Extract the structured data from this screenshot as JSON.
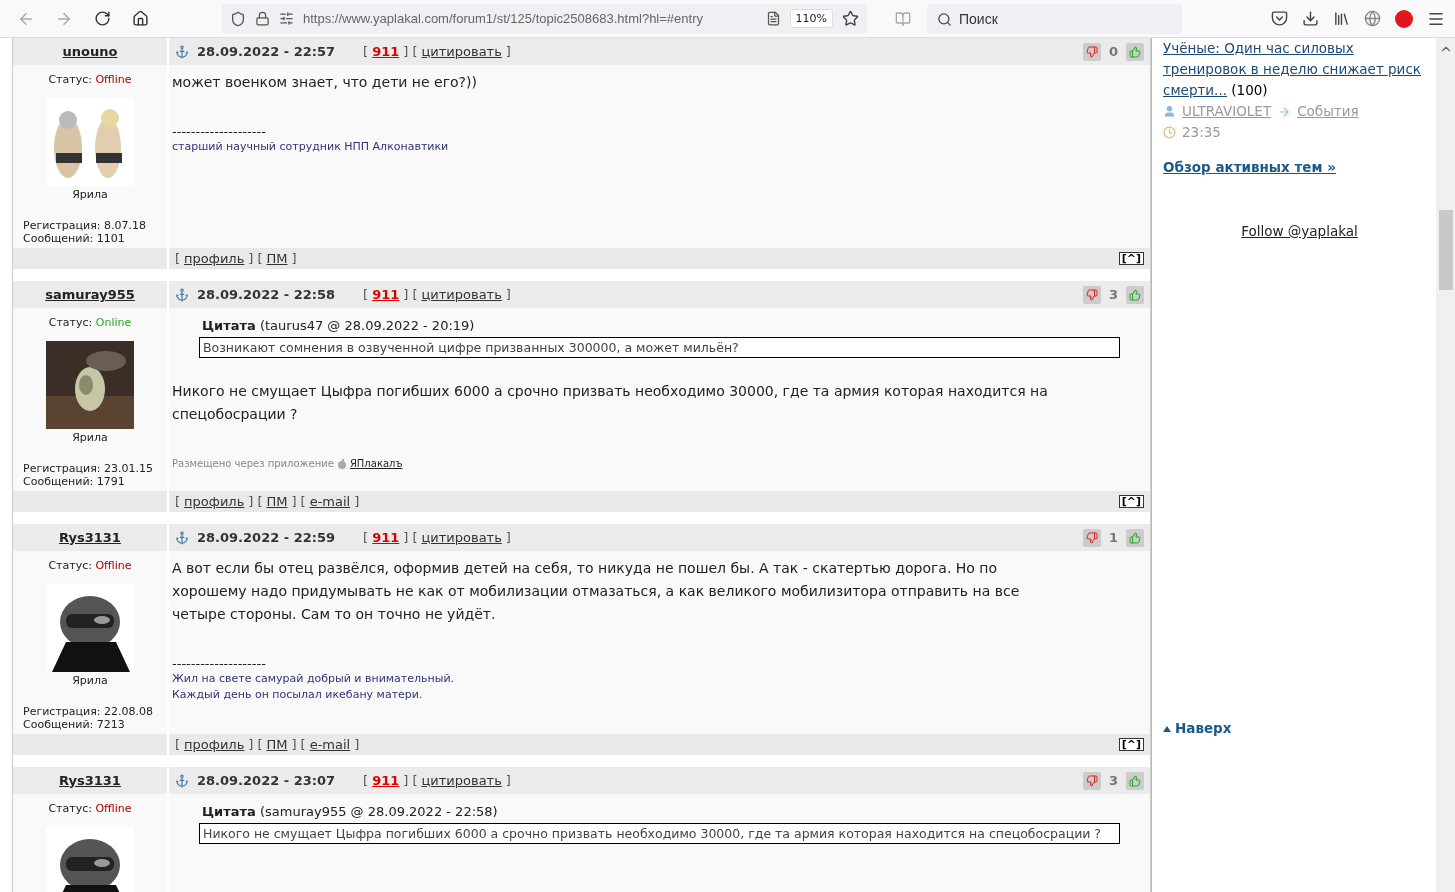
{
  "browser": {
    "url": "https://www.yaplakal.com/forum1/st/125/topic2508683.html?hl=#entry",
    "zoom": "110%",
    "search_placeholder": "Поиск"
  },
  "ui": {
    "bracket_open": "[",
    "bracket_close": "]"
  },
  "posts": [
    {
      "author": "unouno",
      "status_label": "Статус:",
      "status": "Offline",
      "online": false,
      "rank": "Ярила",
      "registration": "Регистрация: 8.07.18",
      "messages": "Сообщений: 1101",
      "date": "28.09.2022 - 22:57",
      "alert": "911",
      "quote_link": "цитировать",
      "rating": "0",
      "paragraphs": [
        "может военком знает, что дети не его?))"
      ],
      "signature_rule": "--------------------",
      "signature": [
        "старший научный сотрудник НПП Алконавтики"
      ],
      "footer_links": [
        "профиль",
        "ПМ"
      ],
      "top_link": "^"
    },
    {
      "author": "samuray955",
      "status_label": "Статус:",
      "status": "Online",
      "online": true,
      "rank": "Ярила",
      "registration": "Регистрация: 23.01.15",
      "messages": "Сообщений: 1791",
      "date": "28.09.2022 - 22:58",
      "alert": "911",
      "quote_link": "цитировать",
      "rating": "3",
      "quote": {
        "title": "Цитата",
        "meta": "(taurus47 @ 28.09.2022 - 20:19)",
        "text": "Возникают сомнения в озвученной цифре призванных 300000, а может мильён?"
      },
      "paragraphs": [
        "Никого не смущает Цыфра погибших 6000 а срочно призвать необходимо 30000, где та армия которая находится на спецобосрации ?"
      ],
      "via": {
        "label": "Размещено через приложение",
        "app": "ЯПлакалъ"
      },
      "footer_links": [
        "профиль",
        "ПМ",
        "e-mail"
      ],
      "top_link": "^"
    },
    {
      "author": "Rys3131",
      "status_label": "Статус:",
      "status": "Offline",
      "online": false,
      "rank": "Ярила",
      "registration": "Регистрация: 22.08.08",
      "messages": "Сообщений: 7213",
      "date": "28.09.2022 - 22:59",
      "alert": "911",
      "quote_link": "цитировать",
      "rating": "1",
      "paragraphs": [
        "А вот если бы отец развёлся, оформив детей на себя, то никуда не пошел бы. А так - скатертью дорога. Но по хорошему надо придумывать не как от мобилизации отмазаться, а как великого мобилизитора отправить на все четыре стороны. Сам то он точно не уйдёт."
      ],
      "signature_rule": "--------------------",
      "signature": [
        "Жил на свете самурай добрый и внимательный.",
        "Каждый день он посылал икебану матери."
      ],
      "footer_links": [
        "профиль",
        "ПМ",
        "e-mail"
      ],
      "top_link": "^"
    },
    {
      "author": "Rys3131",
      "status_label": "Статус:",
      "status": "Offline",
      "online": false,
      "date": "28.09.2022 - 23:07",
      "alert": "911",
      "quote_link": "цитировать",
      "rating": "3",
      "quote": {
        "title": "Цитата",
        "meta": "(samuray955 @ 28.09.2022 - 22:58)",
        "text": "Никого не смущает Цыфра погибших 6000 а срочно призвать необходимо 30000, где та армия которая находится на спецобосрации ?"
      }
    }
  ],
  "sidebar": {
    "topic": "Учёные: Один час силовых тренировок в неделю снижает риск смерти...",
    "count": "(100)",
    "user": "ULTRAVIOLET",
    "section": "События",
    "time": "23:35",
    "overview": "Обзор активных тем »",
    "follow": "Follow @yaplakal",
    "to_top": "Наверх"
  }
}
